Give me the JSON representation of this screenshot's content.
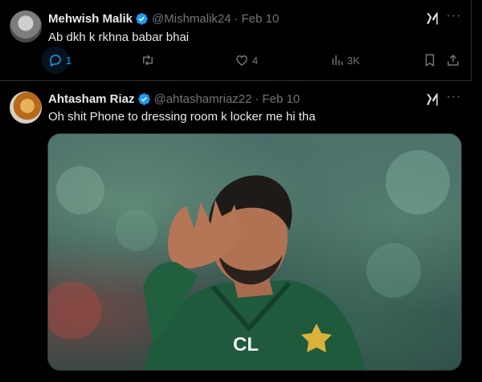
{
  "tweets": [
    {
      "name": "Mehwish Malik",
      "handle": "@Mishmalik24",
      "date": "Feb 10",
      "text": "Ab dkh k rkhna babar bhai",
      "replies": "1",
      "retweets": "",
      "likes": "4",
      "views": "3K"
    },
    {
      "name": "Ahtasham Riaz",
      "handle": "@ahtashamriaz22",
      "date": "Feb 10",
      "text": "Oh shit Phone to dressing room k locker me hi tha",
      "media_text": "CL"
    }
  ],
  "separator": "·",
  "more_glyph": "···",
  "colors": {
    "accent": "#1d9bf0",
    "muted": "#71767b",
    "text": "#e7e9ea",
    "background": "#000000",
    "border": "#2f3336"
  },
  "icons": [
    "verified-badge-icon",
    "grok-icon",
    "more-icon",
    "reply-icon",
    "retweet-icon",
    "like-icon",
    "views-icon",
    "bookmark-icon",
    "share-icon"
  ]
}
